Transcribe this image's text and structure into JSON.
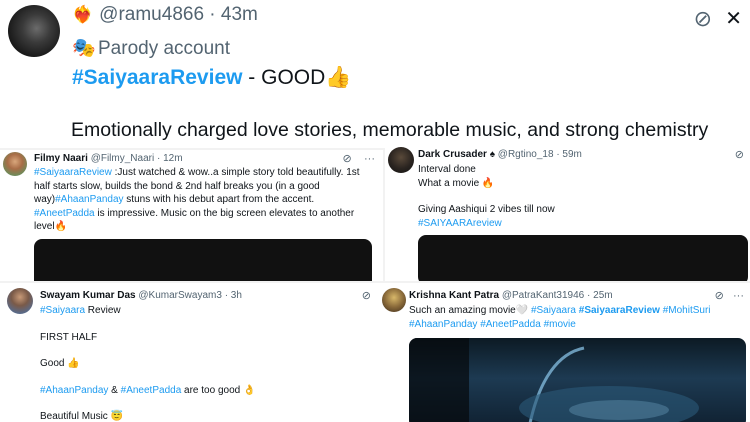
{
  "main": {
    "handle_emoji": "❤️‍🔥",
    "handle": "@ramu4866",
    "dot": "·",
    "time": "43m",
    "parody_icon": "🎭",
    "parody_label": "Parody account",
    "hashtag": "#SaiyaaraReview",
    "verdict": " - GOOD👍",
    "text": "Emotionally charged love stories, memorable music, and strong chemistry",
    "grok_icon": "⊘",
    "close_icon": "✕"
  },
  "card1": {
    "name": "Filmy Naari",
    "handle": "@Filmy_Naari",
    "time": "· 12m",
    "hashtag": "#SaiyaaraReview",
    "text1": " :Just watched & wow..a simple story told beautifully. 1st half starts slow, builds the bond & 2nd half breaks you (in a good way)",
    "hashtag2": "#AhaanPanday",
    "text2": " stuns with his debut apart from the accent. ",
    "hashtag3": "#AneetPadda",
    "text3": " is impressive. Music on the big screen elevates to another level🔥"
  },
  "card2": {
    "name": "Dark Crusader",
    "badge": "♠",
    "handle": "@Rgtino_18",
    "time": "· 59m",
    "line1": "Interval done",
    "line2": "What a movie 🔥",
    "line3": "Giving Aashiqui 2 vibes till now",
    "hashtag": "#SAIYAARAreview"
  },
  "card3": {
    "name": "Swayam Kumar Das",
    "handle": "@KumarSwayam3",
    "time": "· 3h",
    "hashtag": "#Saiyaara",
    "line1_rest": " Review",
    "line2": "FIRST HALF",
    "line3": "Good 👍",
    "hashtag2": "#AhaanPanday",
    "amp": " & ",
    "hashtag3": "#AneetPadda",
    "line4_rest": " are too good 👌",
    "line5": "Beautiful Music 😇"
  },
  "card4": {
    "name": "Krishna Kant Patra",
    "handle": "@PatraKant31946",
    "time": "· 25m",
    "text1": "Such an amazing movie🤍 ",
    "hashtag1": "#Saiyaara",
    "hashtag2": "#SaiyaaraReview",
    "hashtag3": "#MohitSuri",
    "hashtag4": "#AhaanPanday",
    "hashtag5": "#AneetPadda",
    "hashtag6": "#movie"
  },
  "icons": {
    "grok": "⊘",
    "more": "···"
  },
  "colors": {
    "link": "#1d9bf0",
    "text": "#0f1419",
    "muted": "#536471",
    "background": "#f2f2f2"
  }
}
